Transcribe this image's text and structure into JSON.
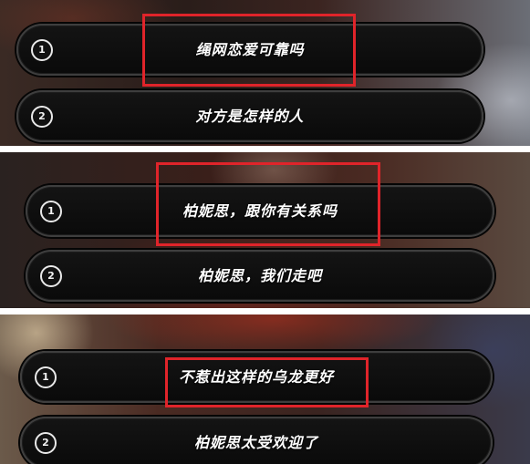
{
  "panels": [
    {
      "options": [
        {
          "number": "1",
          "text": "绳网恋爱可靠吗",
          "highlighted": true
        },
        {
          "number": "2",
          "text": "对方是怎样的人",
          "highlighted": false
        }
      ]
    },
    {
      "options": [
        {
          "number": "1",
          "text": "柏妮思，跟你有关系吗",
          "highlighted": true
        },
        {
          "number": "2",
          "text": "柏妮思，我们走吧",
          "highlighted": false
        }
      ]
    },
    {
      "options": [
        {
          "number": "1",
          "text": "不惹出这样的乌龙更好",
          "highlighted": true
        },
        {
          "number": "2",
          "text": "柏妮思太受欢迎了",
          "highlighted": false
        }
      ]
    }
  ],
  "colors": {
    "highlight_box": "#e0242a",
    "option_background": "#0e0e0e",
    "option_border": "#3e3e3e",
    "text": "#ffffff"
  }
}
